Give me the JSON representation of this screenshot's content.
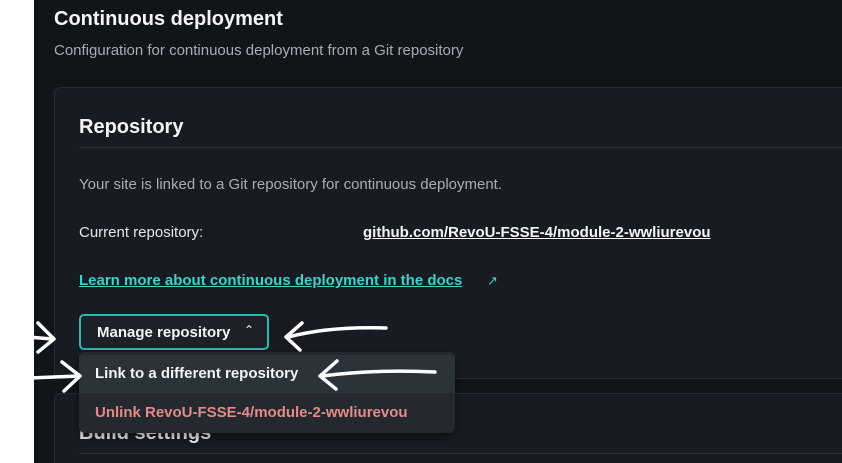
{
  "section": {
    "title": "Continuous deployment",
    "subtitle": "Configuration for continuous deployment from a Git repository"
  },
  "repository_card": {
    "title": "Repository",
    "description": "Your site is linked to a Git repository for continuous deployment.",
    "current_repo_label": "Current repository:",
    "current_repo_value": "github.com/RevoU-FSSE-4/module-2-wwliurevou",
    "docs_link": "Learn more about continuous deployment in the docs",
    "docs_link_icon": "external-link-icon",
    "manage_button_label": "Manage repository",
    "manage_button_icon": "chevron-up-icon"
  },
  "dropdown": {
    "items": [
      {
        "label": "Link to a different repository"
      },
      {
        "label": "Unlink RevoU-FSSE-4/module-2-wwliurevou"
      }
    ]
  },
  "next_card": {
    "title": "Build settings"
  },
  "colors": {
    "background": "#111418",
    "card": "#181c22",
    "accent": "#3fd0c9",
    "danger": "#e48a87"
  }
}
